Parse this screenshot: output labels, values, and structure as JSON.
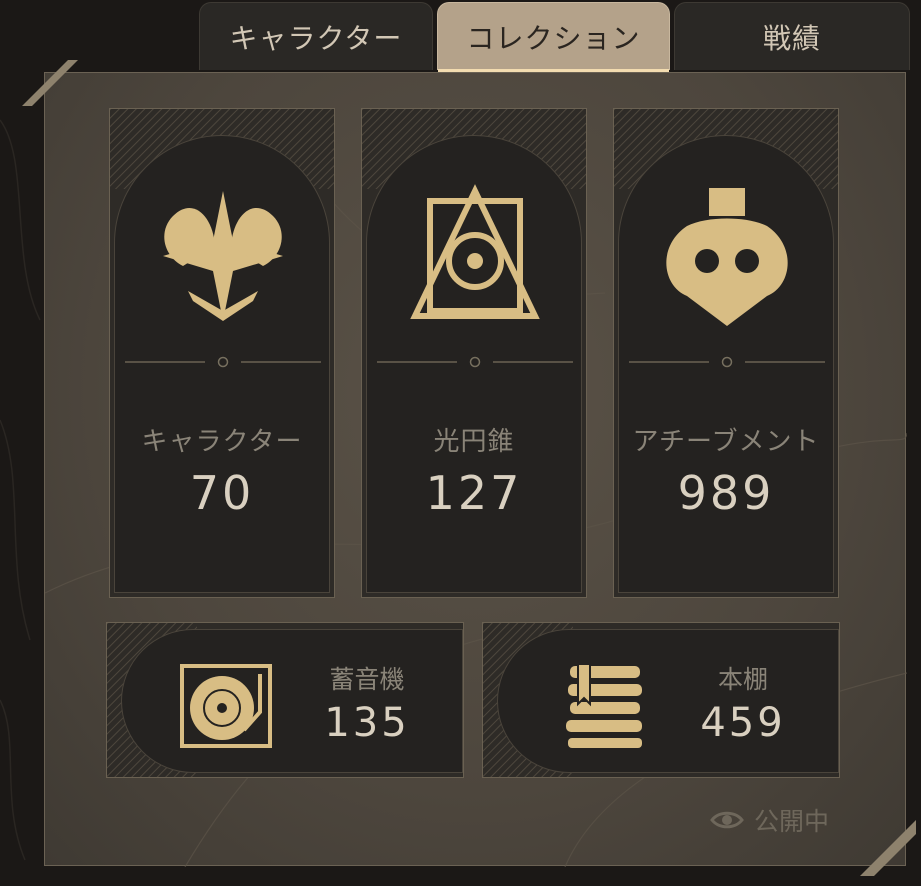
{
  "tabs": [
    {
      "label": "キャラクター",
      "active": false
    },
    {
      "label": "コレクション",
      "active": true
    },
    {
      "label": "戦績",
      "active": false
    }
  ],
  "cards": [
    {
      "label": "キャラクター",
      "value": "70",
      "icon": "character-emblem-icon"
    },
    {
      "label": "光円錐",
      "value": "127",
      "icon": "light-cone-emblem-icon"
    },
    {
      "label": "アチーブメント",
      "value": "989",
      "icon": "achievement-emblem-icon"
    }
  ],
  "bottom_cards": [
    {
      "label": "蓄音機",
      "value": "135",
      "icon": "phonograph-icon"
    },
    {
      "label": "本棚",
      "value": "459",
      "icon": "bookshelf-icon"
    }
  ],
  "status": {
    "label": "公開中",
    "icon": "eye-icon"
  },
  "colors": {
    "accent": "#b4a28a",
    "gold": "#d8bd84",
    "panel": "#4d463d",
    "card": "#242220"
  }
}
